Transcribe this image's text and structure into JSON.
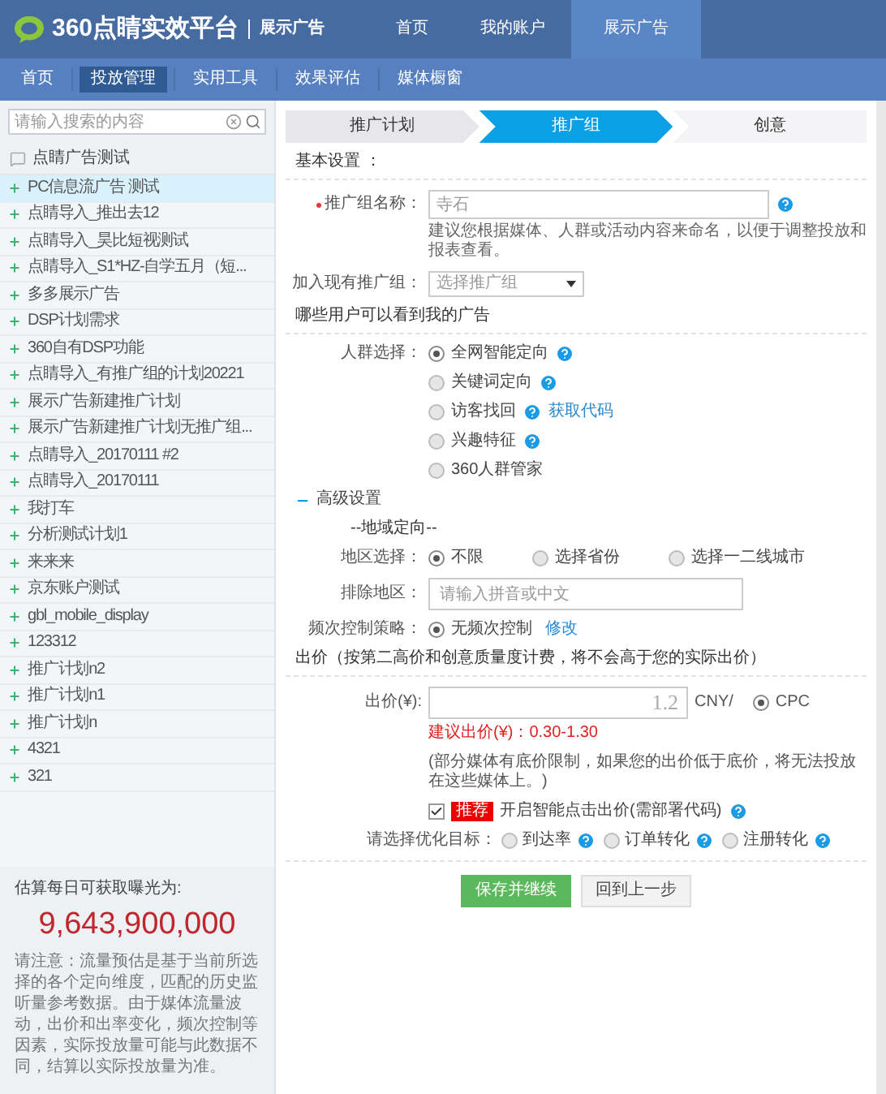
{
  "header": {
    "logo_text": "360点睛实效平台",
    "product": "展示广告",
    "nav": [
      {
        "label": "首页",
        "selected": false
      },
      {
        "label": "我的账户",
        "selected": false
      },
      {
        "label": "展示广告",
        "selected": true
      }
    ]
  },
  "subnav": [
    {
      "label": "首页",
      "selected": false
    },
    {
      "label": "投放管理",
      "selected": true
    },
    {
      "label": "实用工具",
      "selected": false
    },
    {
      "label": "效果评估",
      "selected": false
    },
    {
      "label": "媒体橱窗",
      "selected": false
    }
  ],
  "sidebar": {
    "search": {
      "placeholder": "请输入搜索的内容"
    },
    "root": {
      "label": "点睛广告测试"
    },
    "items": [
      {
        "label": "PC信息流广告 测试",
        "selected": true
      },
      {
        "label": "点睛导入_推出去12",
        "selected": false
      },
      {
        "label": "点睛导入_昊比短视测试",
        "selected": false
      },
      {
        "label": "点睛导入_S1*HZ-自学五月（短...",
        "selected": false
      },
      {
        "label": "多多展示广告",
        "selected": false
      },
      {
        "label": "DSP计划需求",
        "selected": false
      },
      {
        "label": "360自有DSP功能",
        "selected": false
      },
      {
        "label": "点睛导入_有推广组的计划20221",
        "selected": false
      },
      {
        "label": "展示广告新建推广计划",
        "selected": false
      },
      {
        "label": "展示广告新建推广计划无推广组...",
        "selected": false
      },
      {
        "label": "点睛导入_20170111 #2",
        "selected": false
      },
      {
        "label": "点睛导入_20170111",
        "selected": false
      },
      {
        "label": "我打车",
        "selected": false
      },
      {
        "label": "分析测试计划1",
        "selected": false
      },
      {
        "label": "来来来",
        "selected": false
      },
      {
        "label": "京东账户测试",
        "selected": false
      },
      {
        "label": "gbl_mobile_display",
        "selected": false
      },
      {
        "label": "123312",
        "selected": false
      },
      {
        "label": "推广计划n2",
        "selected": false
      },
      {
        "label": "推广计划n1",
        "selected": false
      },
      {
        "label": "推广计划n",
        "selected": false
      },
      {
        "label": "4321",
        "selected": false
      },
      {
        "label": "321",
        "selected": false
      }
    ],
    "estimate": {
      "title": "估算每日可获取曝光为:",
      "value": "9,643,900,000",
      "note": "请注意：流量预估是基于当前所选择的各个定向维度，匹配的历史监听量参考数据。由于媒体流量波动，出价和出率变化，频次控制等因素，实际投放量可能与此数据不同，结算以实际投放量为准。"
    }
  },
  "steps": [
    {
      "label": "推广计划",
      "selected": false
    },
    {
      "label": "推广组",
      "selected": true
    },
    {
      "label": "创意",
      "selected": false
    }
  ],
  "basic": {
    "title": "基本设置 ：",
    "name_field": {
      "label": "推广组名称：",
      "required": true,
      "placeholder": "寺石",
      "hint": "建议您根据媒体、人群或活动内容来命名，以便于调整投放和报表查看。"
    },
    "join_group": {
      "label": "加入现有推广组：",
      "placeholder": "选择推广组"
    }
  },
  "audience": {
    "title": "哪些用户可以看到我的广告",
    "label": "人群选择：",
    "options": [
      {
        "label": "全网智能定向",
        "selected": true,
        "help": true
      },
      {
        "label": "关键词定向",
        "selected": false,
        "help": true
      },
      {
        "label": "访客找回",
        "selected": false,
        "help": true,
        "link": "获取代码"
      },
      {
        "label": "兴趣特征",
        "selected": false,
        "help": true
      },
      {
        "label": "360人群管家",
        "selected": false,
        "help": false
      }
    ]
  },
  "advanced": {
    "title": "高级设置",
    "expanded": true,
    "geo_title": "--地域定向--",
    "region": {
      "label": "地区选择：",
      "options": [
        {
          "label": "不限",
          "selected": true
        },
        {
          "label": "选择省份",
          "selected": false
        },
        {
          "label": "选择一二线城市",
          "selected": false
        }
      ]
    },
    "exclude": {
      "label": "排除地区：",
      "placeholder": "请输入拼音或中文"
    },
    "frequency": {
      "label": "频次控制策略：",
      "options": [
        {
          "label": "无频次控制",
          "selected": true
        }
      ],
      "link": "修改"
    }
  },
  "bid": {
    "title": "出价（按第二高价和创意质量度计费，将不会高于您的实际出价）",
    "label": "出价(¥):",
    "value": "1.2",
    "unit": "CNY/",
    "mode": {
      "label": "CPC",
      "selected": true
    },
    "suggest": "建议出价(¥)：0.30-1.30",
    "note": "(部分媒体有底价限制，如果您的出价低于底价，将无法投放在这些媒体上。)",
    "smart": {
      "checked": true,
      "badge": "推荐",
      "label": "开启智能点击出价(需部署代码)",
      "help": true
    },
    "goal": {
      "label": "请选择优化目标：",
      "options": [
        {
          "label": "到达率",
          "selected": false,
          "help": true
        },
        {
          "label": "订单转化",
          "selected": false,
          "help": true
        },
        {
          "label": "注册转化",
          "selected": false,
          "help": true
        }
      ]
    }
  },
  "buttons": [
    {
      "label": "保存并继续",
      "kind": "primary"
    },
    {
      "label": "回到上一步",
      "kind": "secondary"
    }
  ]
}
